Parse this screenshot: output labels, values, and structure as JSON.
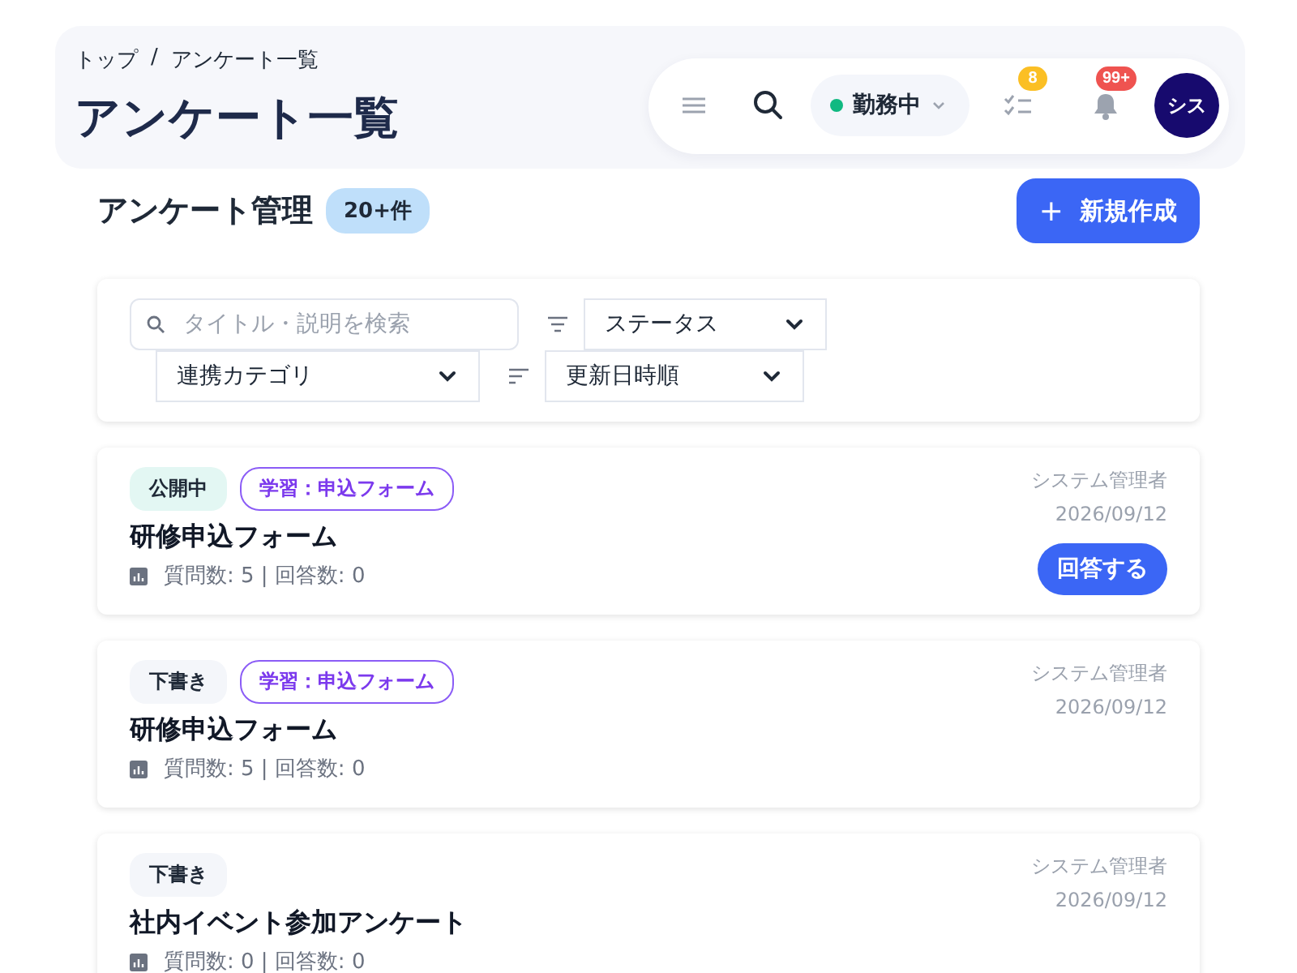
{
  "breadcrumb": [
    {
      "label": "トップ"
    },
    {
      "label": "アンケート一覧"
    }
  ],
  "breadcrumb_separator": "/",
  "page_title": "アンケート一覧",
  "toolbar": {
    "work_status": {
      "label": "勤務中",
      "color": "#10b981"
    },
    "tasks_badge": "8",
    "notifications_badge": "99+",
    "avatar": "シス"
  },
  "section": {
    "title": "アンケート管理",
    "count_badge": "20+件",
    "new_button": "新規作成",
    "new_button_icon": "+"
  },
  "filters": {
    "search": {
      "placeholder": "タイトル・説明を検索"
    },
    "status_select": "ステータス",
    "category_select": "連携カテゴリ",
    "sort_select": "更新日時順"
  },
  "surveys": [
    {
      "status": {
        "label": "公開中",
        "kind": "published"
      },
      "tag": "学習：申込フォーム",
      "title": "研修申込フォーム",
      "stats": "質問数: 5 | 回答数: 0",
      "author": "システム管理者",
      "date": "2026/09/12",
      "action": "回答する"
    },
    {
      "status": {
        "label": "下書き",
        "kind": "draft"
      },
      "tag": "学習：申込フォーム",
      "title": "研修申込フォーム",
      "stats": "質問数: 5 | 回答数: 0",
      "author": "システム管理者",
      "date": "2026/09/12"
    },
    {
      "status": {
        "label": "下書き",
        "kind": "draft"
      },
      "title": "社内イベント参加アンケート",
      "stats": "質問数: 0 | 回答数: 0",
      "author": "システム管理者",
      "date": "2026/09/12"
    }
  ]
}
